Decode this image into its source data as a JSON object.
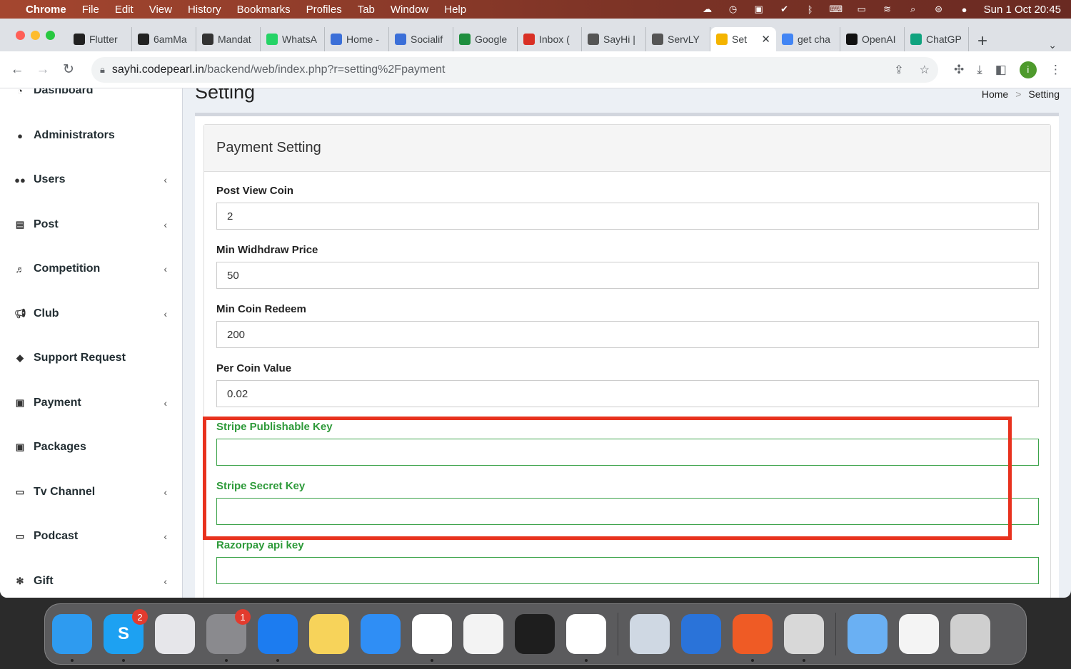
{
  "menubar": {
    "app": "Chrome",
    "items": [
      "File",
      "Edit",
      "View",
      "History",
      "Bookmarks",
      "Profiles",
      "Tab",
      "Window",
      "Help"
    ],
    "clock": "Sun 1 Oct  20:45"
  },
  "tabs": [
    {
      "label": "Flutter",
      "icon": "flutter-icon",
      "color": "#222"
    },
    {
      "label": "6amMa",
      "icon": "flutter-icon",
      "color": "#222"
    },
    {
      "label": "Mandat",
      "icon": "code-icon",
      "color": "#333"
    },
    {
      "label": "WhatsA",
      "icon": "whatsapp-icon",
      "color": "#25d366"
    },
    {
      "label": "Home -",
      "icon": "codepearl-icon",
      "color": "#3b6fd8"
    },
    {
      "label": "Socialif",
      "icon": "codepearl-icon",
      "color": "#3b6fd8"
    },
    {
      "label": "Google",
      "icon": "meet-icon",
      "color": "#1e8e3e"
    },
    {
      "label": "Inbox (",
      "icon": "gmail-icon",
      "color": "#d93025"
    },
    {
      "label": "SayHi |",
      "icon": "globe-icon",
      "color": "#555"
    },
    {
      "label": "ServLY",
      "icon": "globe-icon",
      "color": "#555"
    },
    {
      "label": "Set",
      "icon": "setting-icon",
      "color": "#f4b400",
      "active": true
    },
    {
      "label": "get cha",
      "icon": "google-icon",
      "color": "#4285f4"
    },
    {
      "label": "OpenAI",
      "icon": "openai-icon",
      "color": "#111"
    },
    {
      "label": "ChatGP",
      "icon": "openai-icon",
      "color": "#10a37f"
    }
  ],
  "toolbar": {
    "url_host": "sayhi.codepearl.in",
    "url_path": "/backend/web/index.php?r=setting%2Fpayment",
    "profile_initial": "i"
  },
  "sidebar": {
    "items": [
      {
        "label": "Dashboard",
        "icon": "dashboard-icon",
        "chevron": false
      },
      {
        "label": "Administrators",
        "icon": "user-icon",
        "chevron": false
      },
      {
        "label": "Users",
        "icon": "users-icon",
        "chevron": true
      },
      {
        "label": "Post",
        "icon": "post-icon",
        "chevron": true
      },
      {
        "label": "Competition",
        "icon": "competition-icon",
        "chevron": true
      },
      {
        "label": "Club",
        "icon": "bullhorn-icon",
        "chevron": true
      },
      {
        "label": "Support Request",
        "icon": "tag-icon",
        "chevron": false
      },
      {
        "label": "Payment",
        "icon": "money-icon",
        "chevron": true
      },
      {
        "label": "Packages",
        "icon": "money-icon",
        "chevron": false
      },
      {
        "label": "Tv Channel",
        "icon": "monitor-icon",
        "chevron": true
      },
      {
        "label": "Podcast",
        "icon": "monitor-icon",
        "chevron": true
      },
      {
        "label": "Gift",
        "icon": "gift-icon",
        "chevron": true
      }
    ]
  },
  "page": {
    "title": "Setting",
    "breadcrumb_home": "Home",
    "breadcrumb_current": "Setting",
    "card_title": "Payment Setting"
  },
  "form": {
    "fields": [
      {
        "label": "Post View Coin",
        "value": "2",
        "state": "default"
      },
      {
        "label": "Min Widhdraw Price",
        "value": "50",
        "state": "default"
      },
      {
        "label": "Min Coin Redeem",
        "value": "200",
        "state": "default"
      },
      {
        "label": "Per Coin Value",
        "value": "0.02",
        "state": "default"
      },
      {
        "label": "Stripe Publishable Key",
        "value": "",
        "state": "success"
      },
      {
        "label": "Stripe Secret Key",
        "value": "",
        "state": "success"
      },
      {
        "label": "Razorpay api key",
        "value": "",
        "state": "success"
      }
    ]
  },
  "dock": {
    "apps": [
      {
        "name": "finder",
        "color": "#2e9bf0",
        "dot": true
      },
      {
        "name": "skype",
        "color": "#1da1f2",
        "badge": "2",
        "dot": true,
        "glyph": "S"
      },
      {
        "name": "launchpad",
        "color": "#e6e6ea"
      },
      {
        "name": "system-settings",
        "color": "#8a8a8e",
        "badge": "1",
        "dot": true
      },
      {
        "name": "xcode",
        "color": "#1c7cf0",
        "dot": true
      },
      {
        "name": "notes",
        "color": "#f7d35a"
      },
      {
        "name": "safari",
        "color": "#2f8ef5"
      },
      {
        "name": "chrome",
        "color": "#ffffff",
        "dot": true
      },
      {
        "name": "textedit",
        "color": "#f3f3f3"
      },
      {
        "name": "figma",
        "color": "#1e1e1e"
      },
      {
        "name": "app-store",
        "color": "#ffffff",
        "dot": true
      },
      {
        "name": "preview",
        "color": "#cfd8e3"
      },
      {
        "name": "time-machine",
        "color": "#2a73d9"
      },
      {
        "name": "postman",
        "color": "#ef5b25",
        "dot": true
      },
      {
        "name": "chrome-apps",
        "color": "#d8d8d8",
        "dot": true
      },
      {
        "name": "folder",
        "color": "#6ab0f3"
      },
      {
        "name": "screenshot",
        "color": "#f4f4f4"
      },
      {
        "name": "trash",
        "color": "#cfcfcf"
      }
    ]
  }
}
